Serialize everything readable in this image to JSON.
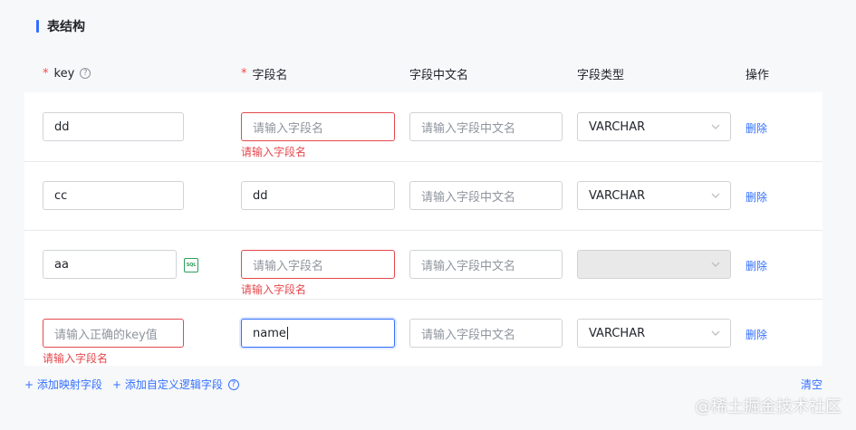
{
  "section": {
    "title": "表结构"
  },
  "headers": {
    "key": "key",
    "field_name": "字段名",
    "field_cn_name": "字段中文名",
    "field_type": "字段类型",
    "actions": "操作",
    "required_mark": "*",
    "help_icon": "?"
  },
  "rows": [
    {
      "key": {
        "value": "dd",
        "placeholder": ""
      },
      "field_name": {
        "value": "",
        "placeholder": "请输入字段名"
      },
      "field_name_error": "请输入字段名",
      "field_cn_name": {
        "value": "",
        "placeholder": "请输入字段中文名"
      },
      "field_type": "VARCHAR",
      "delete": "删除"
    },
    {
      "key": {
        "value": "cc",
        "placeholder": ""
      },
      "field_name": {
        "value": "dd",
        "placeholder": ""
      },
      "field_cn_name": {
        "value": "",
        "placeholder": "请输入字段中文名"
      },
      "field_type": "VARCHAR",
      "delete": "删除"
    },
    {
      "key": {
        "value": "aa",
        "placeholder": ""
      },
      "sql_badge": "SQL",
      "field_name": {
        "value": "",
        "placeholder": "请输入字段名"
      },
      "field_name_error": "请输入字段名",
      "field_cn_name": {
        "value": "",
        "placeholder": "请输入字段中文名"
      },
      "field_type": "",
      "delete": "删除"
    },
    {
      "key": {
        "value": "",
        "placeholder": "请输入正确的key值"
      },
      "key_error": "请输入字段名",
      "field_name": {
        "value": "name",
        "placeholder": ""
      },
      "field_cn_name": {
        "value": "",
        "placeholder": "请输入字段中文名"
      },
      "field_type": "VARCHAR",
      "delete": "删除"
    }
  ],
  "footer": {
    "add_mapping": "+ 添加映射字段",
    "add_custom": "+ 添加自定义逻辑字段",
    "clear": "清空"
  },
  "watermark": "@稀土掘金技术社区",
  "colors": {
    "accent": "#3370ff",
    "error": "#e5484d",
    "sql_badge": "#2f9e5b"
  }
}
